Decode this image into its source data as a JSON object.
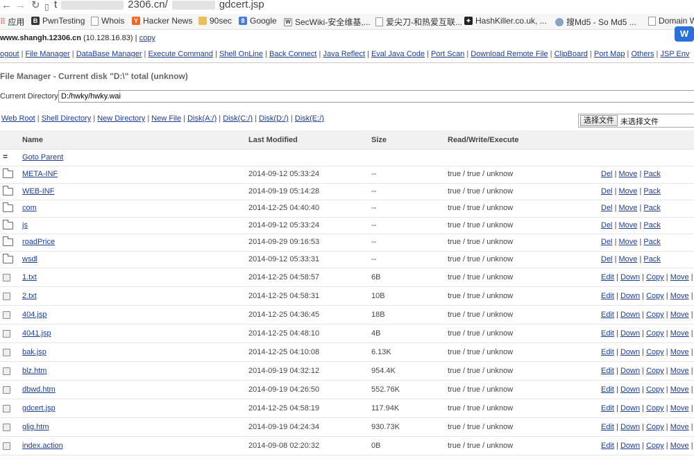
{
  "browser": {
    "url_prefix": "t",
    "url_mid": "2306.cn/",
    "url_suffix": "gdcert.jsp",
    "bookmarks": [
      {
        "label": "应用",
        "icon": "apps-grid-icon"
      },
      {
        "label": "PwnTesting",
        "icon": "pwntesting-icon"
      },
      {
        "label": "Whois",
        "icon": "page-icon"
      },
      {
        "label": "Hacker News",
        "icon": "hacker-news-icon"
      },
      {
        "label": "90sec",
        "icon": "folder-icon"
      },
      {
        "label": "Google",
        "icon": "google-icon"
      },
      {
        "label": "SecWiki-安全维基,...",
        "icon": "wikipedia-icon"
      },
      {
        "label": "爱尖刀-和热爱互联...",
        "icon": "page-icon"
      },
      {
        "label": "HashKiller.co.uk, ...",
        "icon": "hashkiller-icon"
      },
      {
        "label": "搜Md5 - So Md5 ...",
        "icon": "md5-icon"
      },
      {
        "label": "Domain W",
        "icon": "page-icon"
      }
    ]
  },
  "host": {
    "name": "www.shangh.12306.cn",
    "ip": "(10.128.16.83)",
    "copy_label": "copy"
  },
  "menu": [
    "ogout",
    "File Manager",
    "DataBase Manager",
    "Execute Command",
    "Shell OnLine",
    "Back Connect",
    "Java Reflect",
    "Eval Java Code",
    "Port Scan",
    "Download Remote File",
    "ClipBoard",
    "Port Map",
    "Others",
    "JSP Env"
  ],
  "title": "File Manager - Current disk \"D:\\\" total (unknow)",
  "current_directory": {
    "label": "Current Directory",
    "value": "D:/hwky/hwky.wai"
  },
  "tools": [
    "Web Root",
    "Shell Directory",
    "New Directory",
    "New File",
    "Disk(A:/)",
    "Disk(C:/)",
    "Disk(D:/)",
    "Disk(E:/)"
  ],
  "file_picker": {
    "button": "选择文件",
    "status": "未选择文件"
  },
  "table": {
    "headers": {
      "name": "Name",
      "modified": "Last Modified",
      "size": "Size",
      "rwe": "Read/Write/Execute"
    },
    "parent": {
      "icon": "equals",
      "label": "Goto Parent"
    },
    "folder_actions": [
      "Del",
      "Move",
      "Pack"
    ],
    "file_actions": [
      "Edit",
      "Down",
      "Copy",
      "Move",
      "P"
    ],
    "folders": [
      {
        "name": "META-INF",
        "modified": "2014-09-12 05:33:24",
        "size": "--",
        "rwe": "true / true / unknow"
      },
      {
        "name": "WEB-INF",
        "modified": "2014-09-19 05:14:28",
        "size": "--",
        "rwe": "true / true / unknow"
      },
      {
        "name": "com",
        "modified": "2014-12-25 04:40:40",
        "size": "--",
        "rwe": "true / true / unknow"
      },
      {
        "name": "js",
        "modified": "2014-09-12 05:33:24",
        "size": "--",
        "rwe": "true / true / unknow"
      },
      {
        "name": "roadPrice",
        "modified": "2014-09-29 09:16:53",
        "size": "--",
        "rwe": "true / true / unknow"
      },
      {
        "name": "wsdl",
        "modified": "2014-09-12 05:33:31",
        "size": "--",
        "rwe": "true / true / unknow"
      }
    ],
    "files": [
      {
        "name": "1.txt",
        "modified": "2014-12-25 04:58:57",
        "size": "6B",
        "rwe": "true / true / unknow"
      },
      {
        "name": "2.txt",
        "modified": "2014-12-25 04:58:31",
        "size": "10B",
        "rwe": "true / true / unknow"
      },
      {
        "name": "404.jsp",
        "modified": "2014-12-25 04:36:45",
        "size": "18B",
        "rwe": "true / true / unknow"
      },
      {
        "name": "4041.jsp",
        "modified": "2014-12-25 04:48:10",
        "size": "4B",
        "rwe": "true / true / unknow"
      },
      {
        "name": "bak.jsp",
        "modified": "2014-12-25 04:10:08",
        "size": "6.13K",
        "rwe": "true / true / unknow"
      },
      {
        "name": "blz.htm",
        "modified": "2014-09-19 04:32:12",
        "size": "954.4K",
        "rwe": "true / true / unknow"
      },
      {
        "name": "dbwd.htm",
        "modified": "2014-09-19 04:26:50",
        "size": "552.76K",
        "rwe": "true / true / unknow"
      },
      {
        "name": "gdcert.jsp",
        "modified": "2014-12-25 04:58:19",
        "size": "117.94K",
        "rwe": "true / true / unknow"
      },
      {
        "name": "glig.htm",
        "modified": "2014-09-19 04:24:34",
        "size": "930.73K",
        "rwe": "true / true / unknow"
      },
      {
        "name": "index.action",
        "modified": "2014-09-08 02:20:32",
        "size": "0B",
        "rwe": "true / true / unknow"
      }
    ]
  }
}
